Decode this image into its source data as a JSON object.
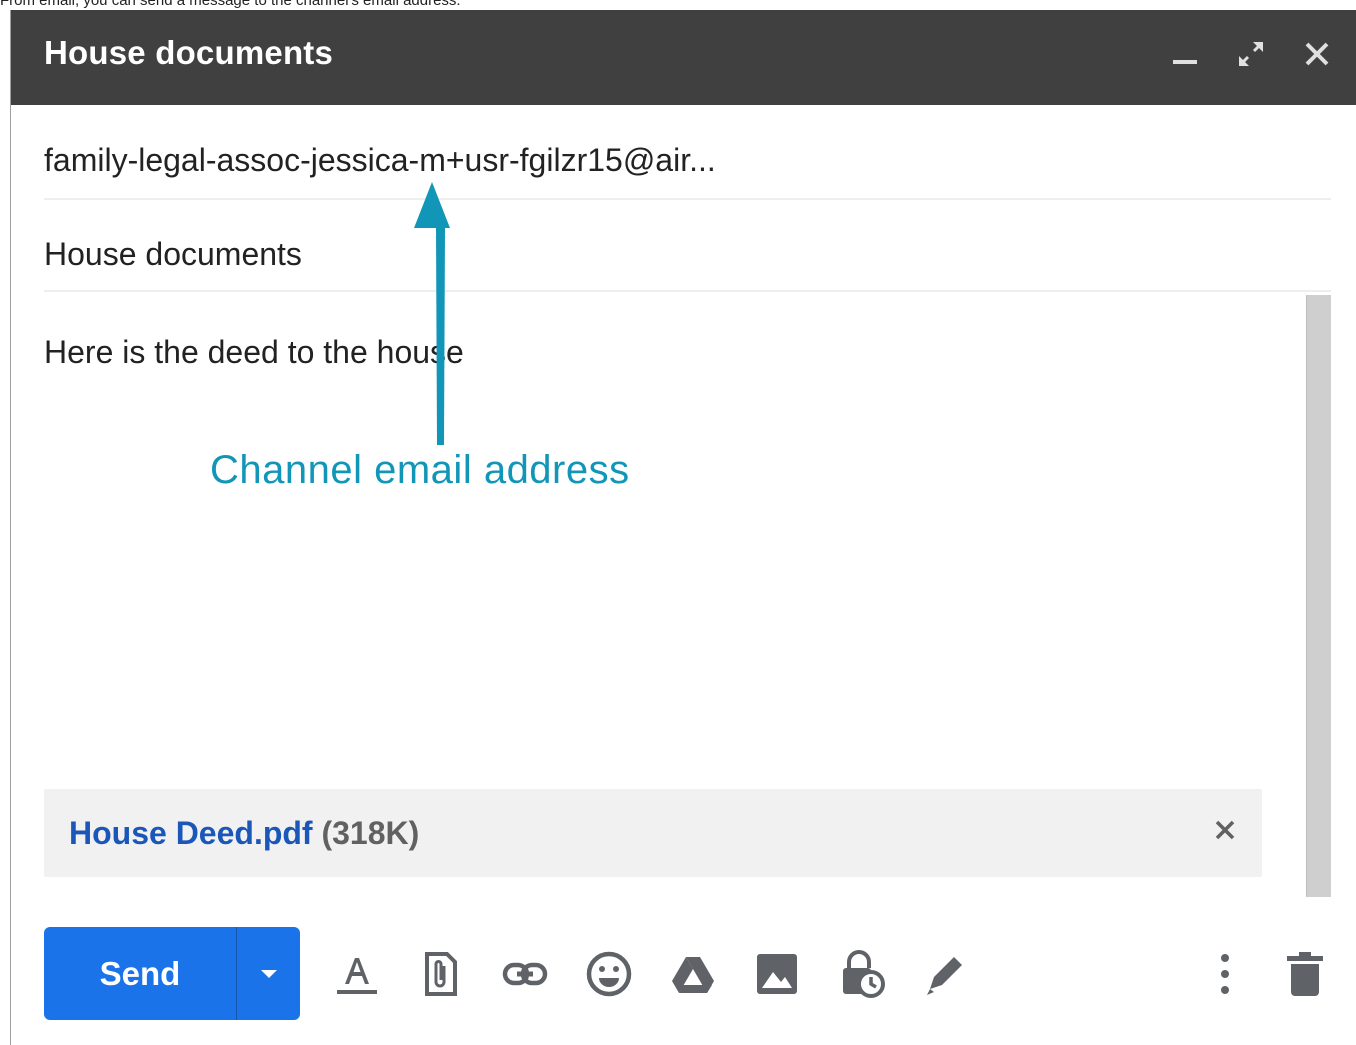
{
  "caption": "From email, you can send a message to the channel's email address.",
  "compose": {
    "title": "House documents",
    "recipient": "family-legal-assoc-jessica-m+usr-fgilzr15@air...",
    "subject": "House documents",
    "body": "Here is the deed to the house"
  },
  "attachment": {
    "name": "House Deed.pdf",
    "size": "(318K)"
  },
  "send_label": "Send",
  "annotation": {
    "label": "Channel email address"
  },
  "colors": {
    "header_bg": "#404040",
    "send_bg": "#1a73e8",
    "annotation": "#1296b8",
    "link": "#1a57b8",
    "icon": "#5f6368"
  },
  "icons": {
    "header": [
      "minimize-icon",
      "expand-icon",
      "close-icon"
    ],
    "toolbar": [
      "formatting-icon",
      "attach-icon",
      "link-icon",
      "emoji-icon",
      "drive-icon",
      "image-icon",
      "confidential-icon",
      "signature-icon",
      "more-options-icon",
      "delete-icon"
    ]
  }
}
